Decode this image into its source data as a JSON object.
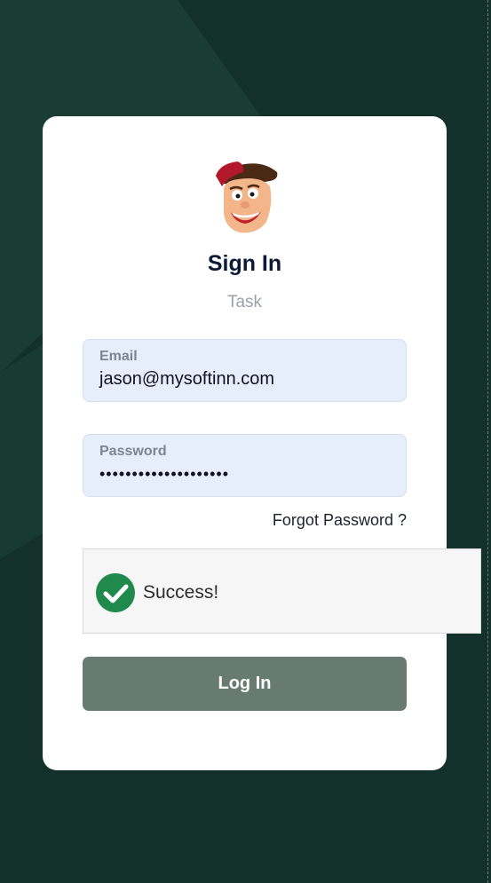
{
  "login_form": {
    "title": "Sign In",
    "subtitle": "Task",
    "email": {
      "label": "Email",
      "value": "jason@mysoftinn.com"
    },
    "password": {
      "label": "Password",
      "value": "••••••••••••••••••••"
    },
    "forgot_password_label": "Forgot Password ?",
    "captcha": {
      "status_text": "Success!",
      "icon": "check-circle-icon"
    },
    "login_button_label": "Log In",
    "avatar_icon": "cartoon-mascot-avatar"
  },
  "colors": {
    "background": "#13312a",
    "card": "#ffffff",
    "field_background": "#e6eefb",
    "login_button": "#677b73",
    "success": "#1f8a4c"
  }
}
